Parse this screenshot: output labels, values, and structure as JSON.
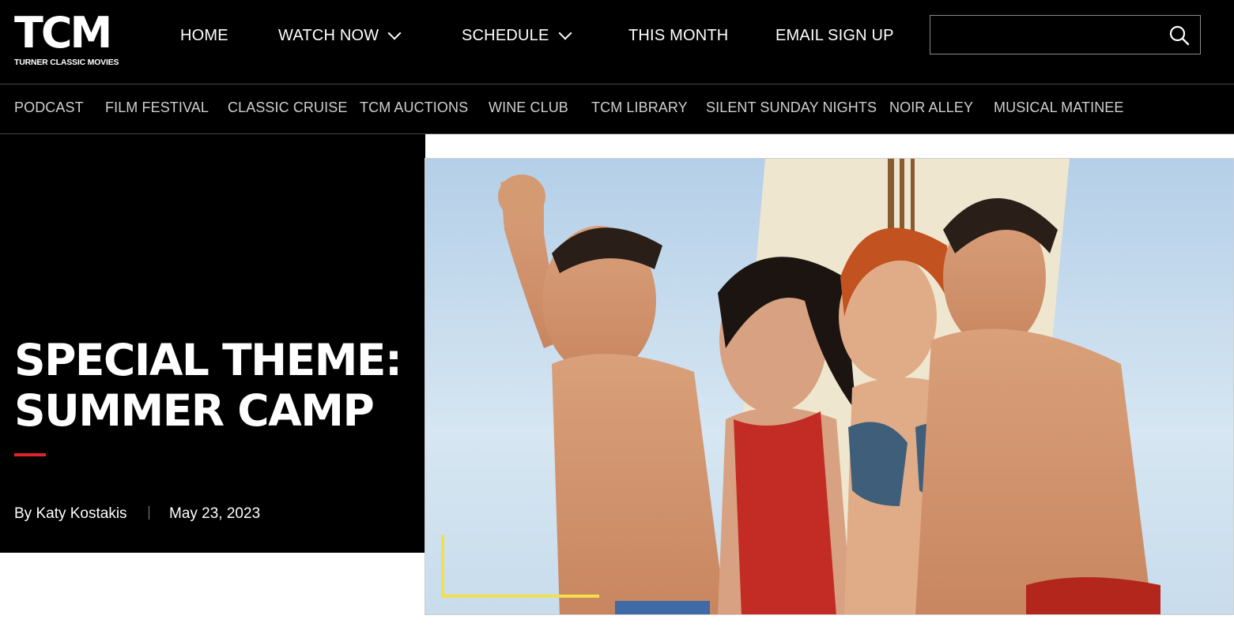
{
  "brand": {
    "logo_mark": "TCM",
    "logo_subtitle": "TURNER CLASSIC MOVIES"
  },
  "main_nav": [
    {
      "label": "HOME",
      "has_dropdown": false
    },
    {
      "label": "WATCH NOW",
      "has_dropdown": true
    },
    {
      "label": "SCHEDULE",
      "has_dropdown": true
    },
    {
      "label": "THIS MONTH",
      "has_dropdown": false
    },
    {
      "label": "EMAIL SIGN UP",
      "has_dropdown": false
    }
  ],
  "search": {
    "value": "",
    "placeholder": "",
    "icon": "search-icon"
  },
  "sub_nav": [
    "PODCAST",
    "FILM FESTIVAL",
    "CLASSIC CRUISE",
    "TCM AUCTIONS",
    "WINE CLUB",
    "TCM LIBRARY",
    "SILENT SUNDAY NIGHTS",
    "NOIR ALLEY",
    "MUSICAL MATINEE"
  ],
  "article": {
    "title_line1": "SPECIAL THEME:",
    "title_line2": "SUMMER CAMP",
    "byline": "By Katy Kostakis",
    "date": "May 23, 2023"
  },
  "colors": {
    "background": "#000000",
    "accent_red": "#e0242a",
    "accent_yellow": "#f2df4a",
    "nav_text": "#ffffff",
    "subnav_text": "#cfcfcf"
  }
}
